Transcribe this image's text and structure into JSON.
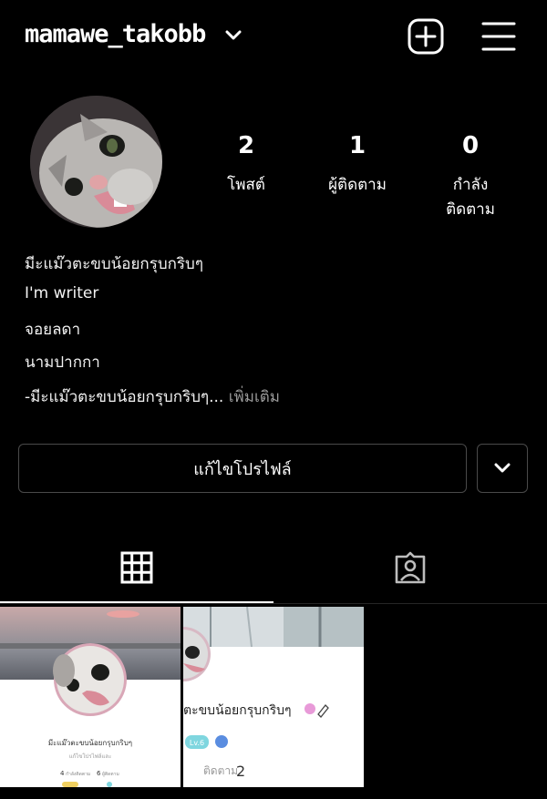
{
  "header": {
    "username": "mamawe_takobb",
    "icons": [
      "chevron-down-icon",
      "plus-square-icon",
      "hamburger-menu-icon"
    ]
  },
  "stats": [
    {
      "value": "2",
      "label": "โพสต์"
    },
    {
      "value": "1",
      "label": "ผู้ติดตาม"
    },
    {
      "value": "0",
      "label": "กำลังติดตาม"
    }
  ],
  "bio": {
    "line1": "มีะแม๊วตะขบน้อยกรุบกริบๆ",
    "line2": "I'm writer",
    "line3": "จอยลดา",
    "line4": "นามปากกา",
    "line5": "-มีะแม๊วตะขบน้อยกรุบกริบๆ...",
    "more": "เพิ่มเติม"
  },
  "buttons": {
    "edit_profile": "แก้ไขโปรไฟล์"
  },
  "tabs": [
    "grid-icon",
    "tagged-person-icon"
  ],
  "posts": {
    "post1": {
      "name": "มีะแม๊วตะขบน้อยกรุบกริบๆ",
      "subtitle": "แก้ไขโปรไฟล์และ",
      "following_count": "4",
      "following_label": "กำลังติดตาม",
      "followers_count": "6",
      "followers_label": "ผู้ติดตาม"
    },
    "post2": {
      "name": "ตะขบน้อยกรุบกริบๆ",
      "level": "Lv.6",
      "follow_label": "ติดตาม",
      "follow_count": "2"
    }
  },
  "colors": {
    "background": "#000000",
    "text": "#ffffff",
    "border": "#4a4a4a",
    "more_link": "#9a9a9a",
    "level_badge": "#7fd6df",
    "pink_badge": "#e89ad8"
  }
}
